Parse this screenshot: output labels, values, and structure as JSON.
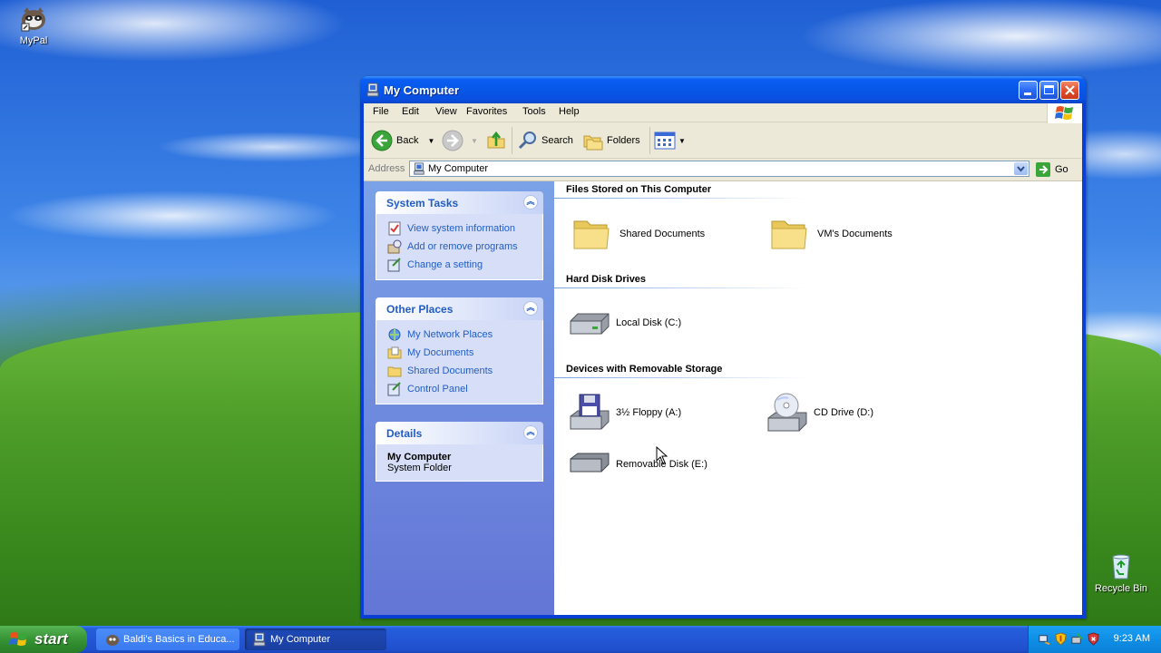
{
  "desktop": {
    "icons": [
      {
        "label": "MyPal",
        "icon": "mypal-icon"
      },
      {
        "label": "Recycle Bin",
        "icon": "recycle-bin-icon"
      }
    ]
  },
  "window": {
    "title": "My Computer",
    "menu": [
      "File",
      "Edit",
      "View",
      "Favorites",
      "Tools",
      "Help"
    ],
    "toolbar": {
      "back": "Back",
      "search": "Search",
      "folders": "Folders"
    },
    "address": {
      "label": "Address",
      "value": "My Computer",
      "go": "Go"
    },
    "taskpane": {
      "system_tasks": {
        "title": "System Tasks",
        "links": [
          "View system information",
          "Add or remove programs",
          "Change a setting"
        ]
      },
      "other_places": {
        "title": "Other Places",
        "links": [
          "My Network Places",
          "My Documents",
          "Shared Documents",
          "Control Panel"
        ]
      },
      "details": {
        "title": "Details",
        "name": "My Computer",
        "type": "System Folder"
      }
    },
    "groups": {
      "files": {
        "title": "Files Stored on This Computer",
        "items": [
          "Shared Documents",
          "VM's Documents"
        ]
      },
      "hdd": {
        "title": "Hard Disk Drives",
        "items": [
          "Local Disk (C:)"
        ]
      },
      "removable": {
        "title": "Devices with Removable Storage",
        "items": [
          "3½ Floppy (A:)",
          "CD Drive (D:)",
          "Removable Disk (E:)"
        ]
      }
    }
  },
  "taskbar": {
    "start": "start",
    "tasks": [
      "Baldi's Basics in Educa...",
      "My Computer"
    ],
    "clock": "9:23 AM"
  },
  "colors": {
    "titlebar": "#0a5ef2",
    "taskpane_link": "#215dc6",
    "start_green": "#3c9a3a",
    "taskbar_blue": "#245edb"
  }
}
